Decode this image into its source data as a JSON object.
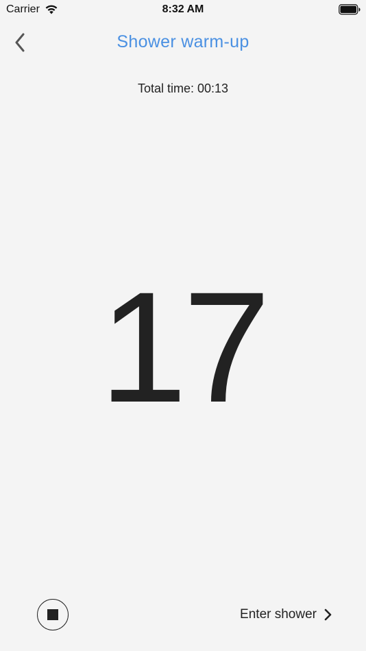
{
  "status_bar": {
    "carrier": "Carrier",
    "time": "8:32 AM",
    "icons": [
      "wifi-icon",
      "battery-icon"
    ]
  },
  "nav": {
    "title": "Shower warm-up",
    "back_icon": "chevron-left-icon",
    "title_color": "#4a90e2"
  },
  "timer": {
    "total_time": "Total time: 00:13",
    "countdown": "17"
  },
  "controls": {
    "stop_icon": "stop-icon",
    "enter_shower_label": "Enter shower",
    "enter_icon": "chevron-right-icon"
  },
  "colors": {
    "background": "#f4f4f4",
    "text": "#222222",
    "accent": "#4a90e2"
  }
}
